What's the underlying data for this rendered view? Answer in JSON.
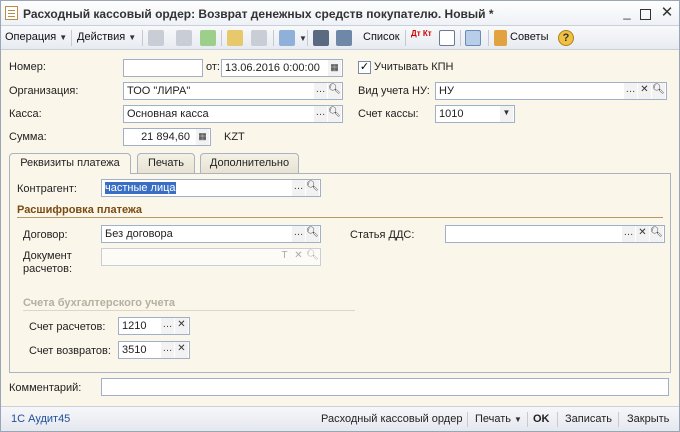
{
  "window": {
    "title": "Расходный кассовый ордер: Возврат денежных средств покупателю. Новый *"
  },
  "toolbar": {
    "operation": "Операция",
    "actions": "Действия",
    "list": "Список",
    "dt_kt": "Дт Кт",
    "advice": "Советы"
  },
  "header": {
    "number_label": "Номер:",
    "number_value": "",
    "from_label": "от:",
    "date_value": "13.06.2016  0:00:00",
    "kpn_label": "Учитывать КПН",
    "kpn_checked": "✓",
    "org_label": "Организация:",
    "org_value": "ТОО \"ЛИРА\"",
    "nu_label": "Вид учета НУ:",
    "nu_value": "НУ",
    "cash_label": "Касса:",
    "cash_value": "Основная касса",
    "cash_account_label": "Счет кассы:",
    "cash_account_value": "1010",
    "sum_label": "Сумма:",
    "sum_value": "21 894,60",
    "currency": "KZT"
  },
  "tabs": [
    {
      "label": "Реквизиты платежа"
    },
    {
      "label": "Печать"
    },
    {
      "label": "Дополнительно"
    }
  ],
  "payment": {
    "contractor_label": "Контрагент:",
    "contractor_value": "частные лица",
    "breakdown_title": "Расшифровка платежа",
    "contract_label": "Договор:",
    "contract_value": "Без договора",
    "dds_label": "Статья ДДС:",
    "dds_value": "",
    "doc_label_1": "Документ",
    "doc_label_2": "расчетов:",
    "doc_value": "",
    "accounts_title": "Счета бухгалтерского учета",
    "settle_label": "Счет расчетов:",
    "settle_value": "1210",
    "return_label": "Счет возвратов:",
    "return_value": "3510"
  },
  "comment": {
    "label": "Комментарий:",
    "value": ""
  },
  "statusbar": {
    "left": "1С Аудит45",
    "doc_name": "Расходный кассовый ордер",
    "print": "Печать",
    "ok": "OK",
    "save": "Записать",
    "close": "Закрыть"
  }
}
